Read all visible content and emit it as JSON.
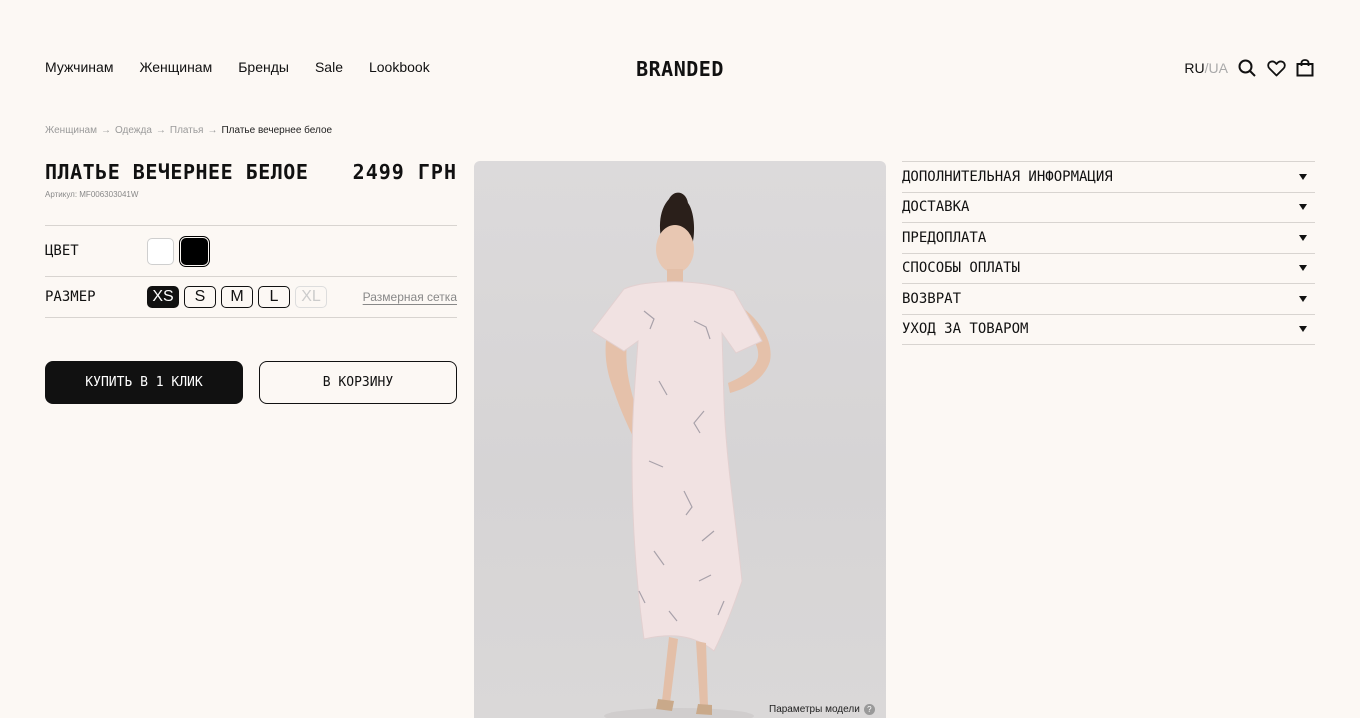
{
  "header": {
    "nav": [
      "Мужчинам",
      "Женщинам",
      "Бренды",
      "Sale",
      "Lookbook"
    ],
    "logo": "BRANDED",
    "lang_active": "RU",
    "lang_sep": "/",
    "lang_inactive": "UA",
    "icons": [
      "search-icon",
      "heart-icon",
      "bag-icon"
    ]
  },
  "breadcrumb": {
    "items": [
      "Женщинам",
      "Одежда",
      "Платья"
    ],
    "arrow": "→",
    "current": "Платье вечернее белое"
  },
  "product": {
    "title": "ПЛАТЬЕ ВЕЧЕРНЕЕ БЕЛОЕ",
    "price": "2499 ГРН",
    "sku": "Артикул: MF006303041W",
    "color_label": "ЦВЕТ",
    "colors": [
      {
        "name": "white",
        "hex": "#ffffff"
      },
      {
        "name": "black",
        "hex": "#000000",
        "selected": true
      }
    ],
    "size_label": "РАЗМЕР",
    "sizes": [
      "XS",
      "S",
      "M",
      "L",
      "XL"
    ],
    "selected_size": "XS",
    "disabled_sizes": [
      "XL"
    ],
    "size_chart_link": "Размерная сетка",
    "buy_one_click": "КУПИТЬ В 1 КЛИК",
    "add_to_cart": "В КОРЗИНУ",
    "model_params": "Параметры модели",
    "model_params_icon": "?"
  },
  "accordion": {
    "items": [
      "ДОПОЛНИТЕЛЬНАЯ ИНФОРМАЦИЯ",
      "ДОСТАВКА",
      "ПРЕДОПЛАТА",
      "СПОСОБЫ ОПЛАТЫ",
      "ВОЗВРАТ",
      "УХОД ЗА ТОВАРОМ"
    ]
  }
}
